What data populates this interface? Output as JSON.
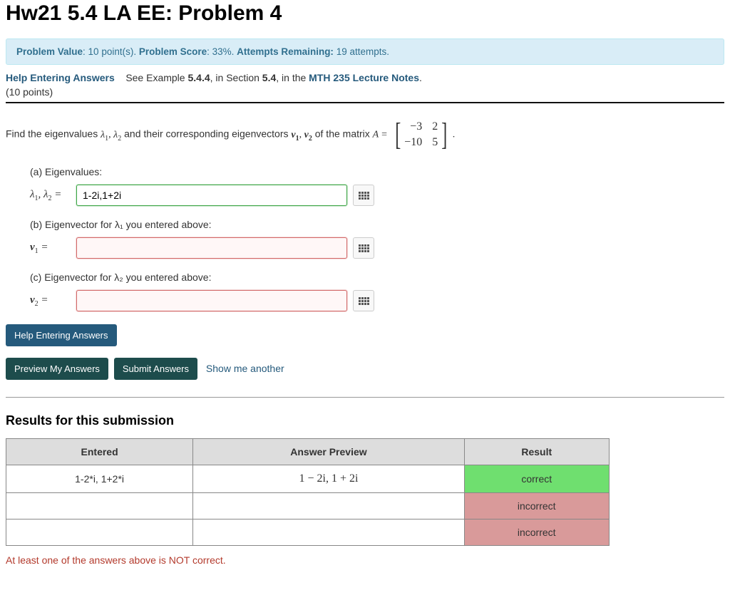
{
  "header": {
    "title": "Hw21 5.4 LA EE: Problem 4"
  },
  "infobar": {
    "value_label": "Problem Value",
    "value_text": ": 10 point(s). ",
    "score_label": "Problem Score",
    "score_text": ": 33%. ",
    "attempts_label": "Attempts Remaining:",
    "attempts_text": " 19 attempts."
  },
  "help": {
    "link_label": "Help Entering Answers",
    "see_prefix": "See Example ",
    "example_ref": "5.4.4",
    "section_prefix": ", in Section ",
    "section_ref": "5.4",
    "notes_prefix": ", in the ",
    "notes_link": "MTH 235 Lecture Notes",
    "period": ".",
    "points": "(10 points)"
  },
  "prompt": {
    "lead": "Find the eigenvalues ",
    "lambda_sym": "λ",
    "and1": " and their corresponding eigenvectors ",
    "v_sym": "v",
    "of_matrix": " of the matrix ",
    "A_sym": "A",
    "equals": " = ",
    "matrix": {
      "r1c1": "−3",
      "r1c2": "2",
      "r2c1": "−10",
      "r2c2": "5"
    },
    "tail": "."
  },
  "parts": {
    "a_label": "(a) Eigenvalues:",
    "a_lhs": "λ₁, λ₂  =",
    "a_value": "1-2i,1+2i",
    "b_label": "(b) Eigenvector for λ₁ you entered above:",
    "b_lhs": "v₁  =",
    "b_value": "",
    "c_label": "(c) Eigenvector for λ₂ you entered above:",
    "c_lhs": "v₂  =",
    "c_value": ""
  },
  "buttons": {
    "help": "Help Entering Answers",
    "preview": "Preview My Answers",
    "submit": "Submit Answers",
    "another": "Show me another"
  },
  "results": {
    "heading": "Results for this submission",
    "col_entered": "Entered",
    "col_preview": "Answer Preview",
    "col_result": "Result",
    "rows": [
      {
        "entered": "1-2*i, 1+2*i",
        "preview": "1 − 2i, 1 + 2i",
        "result": "correct",
        "status": "correct"
      },
      {
        "entered": "",
        "preview": "",
        "result": "incorrect",
        "status": "incorrect"
      },
      {
        "entered": "",
        "preview": "",
        "result": "incorrect",
        "status": "incorrect"
      }
    ],
    "warning": "At least one of the answers above is NOT correct."
  }
}
